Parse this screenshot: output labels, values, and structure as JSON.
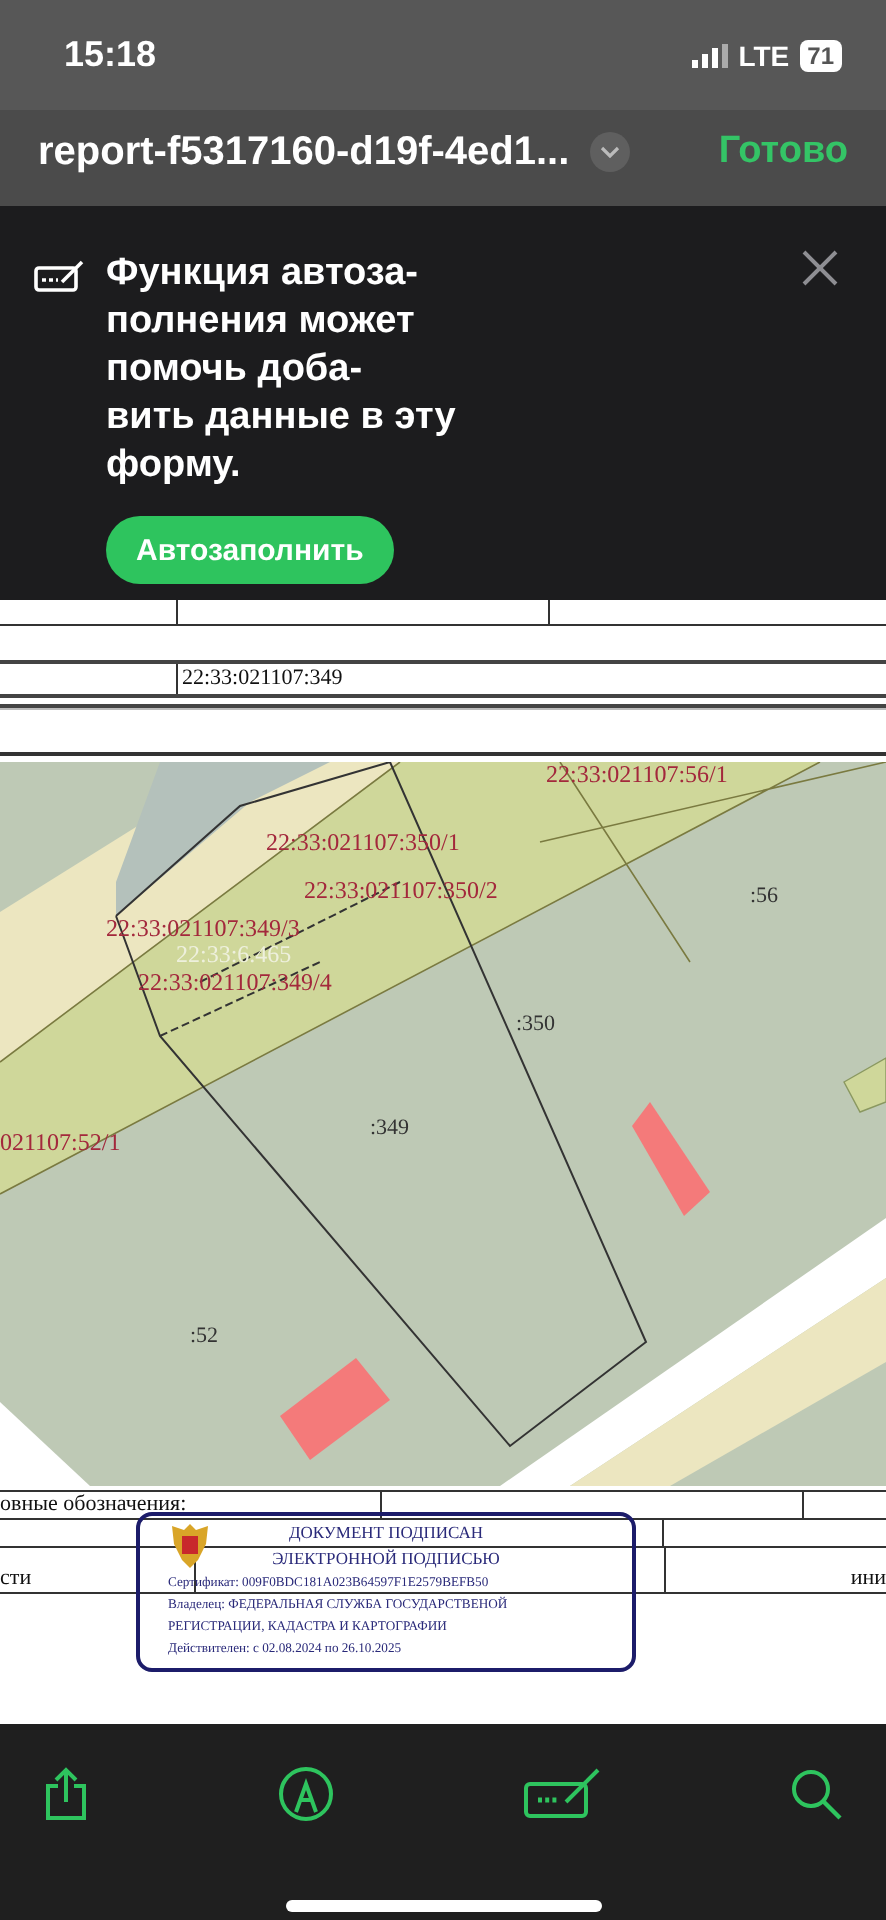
{
  "status_bar": {
    "time": "15:18",
    "network": "LTE",
    "battery": "71"
  },
  "nav_bar": {
    "title": "report-f5317160-d19f-4ed1...",
    "done_button": "Готово"
  },
  "autofill_banner": {
    "message_lines": [
      "Функция автоза-",
      "полнения может",
      "помочь доба-",
      "вить данные в эту",
      "форму."
    ],
    "button": "Автозаполнить"
  },
  "document": {
    "parcel_row": {
      "cadastral_number": "22:33:021107:349"
    },
    "map": {
      "labels": [
        {
          "text": "22:33:021107:56/1",
          "kind": "subparcel"
        },
        {
          "text": "22:33:021107:350/1",
          "kind": "subparcel"
        },
        {
          "text": "22:33:021107:350/2",
          "kind": "subparcel"
        },
        {
          "text": ":56",
          "kind": "parcel"
        },
        {
          "text": "22:33:021107:349/3",
          "kind": "subparcel"
        },
        {
          "text": "22:33:6.465",
          "kind": "zone"
        },
        {
          "text": "22:33:021107:349/4",
          "kind": "subparcel"
        },
        {
          "text": ":350",
          "kind": "parcel"
        },
        {
          "text": "021107:52/1",
          "kind": "subparcel"
        },
        {
          "text": ":349",
          "kind": "parcel"
        },
        {
          "text": ":52",
          "kind": "parcel"
        }
      ]
    },
    "legend_row": {
      "column_1": "овные обозначения:"
    },
    "area_row": {
      "column_1": "сти",
      "column_3": "ини"
    },
    "signature_stamp": {
      "title_lines": [
        "ДОКУМЕНТ ПОДПИСАН",
        "ЭЛЕКТРОННОЙ ПОДПИСЬЮ"
      ],
      "details": [
        "Сертификат: 009F0BDC181A023B64597F1E2579BEFB50",
        "Владелец: ФЕДЕРАЛЬНАЯ СЛУЖБА ГОСУДАРСТВЕНОЙ",
        "РЕГИСТРАЦИИ, КАДАСТРА И КАРТОГРАФИИ",
        "Действителен: с 02.08.2024 по 26.10.2025"
      ]
    }
  }
}
